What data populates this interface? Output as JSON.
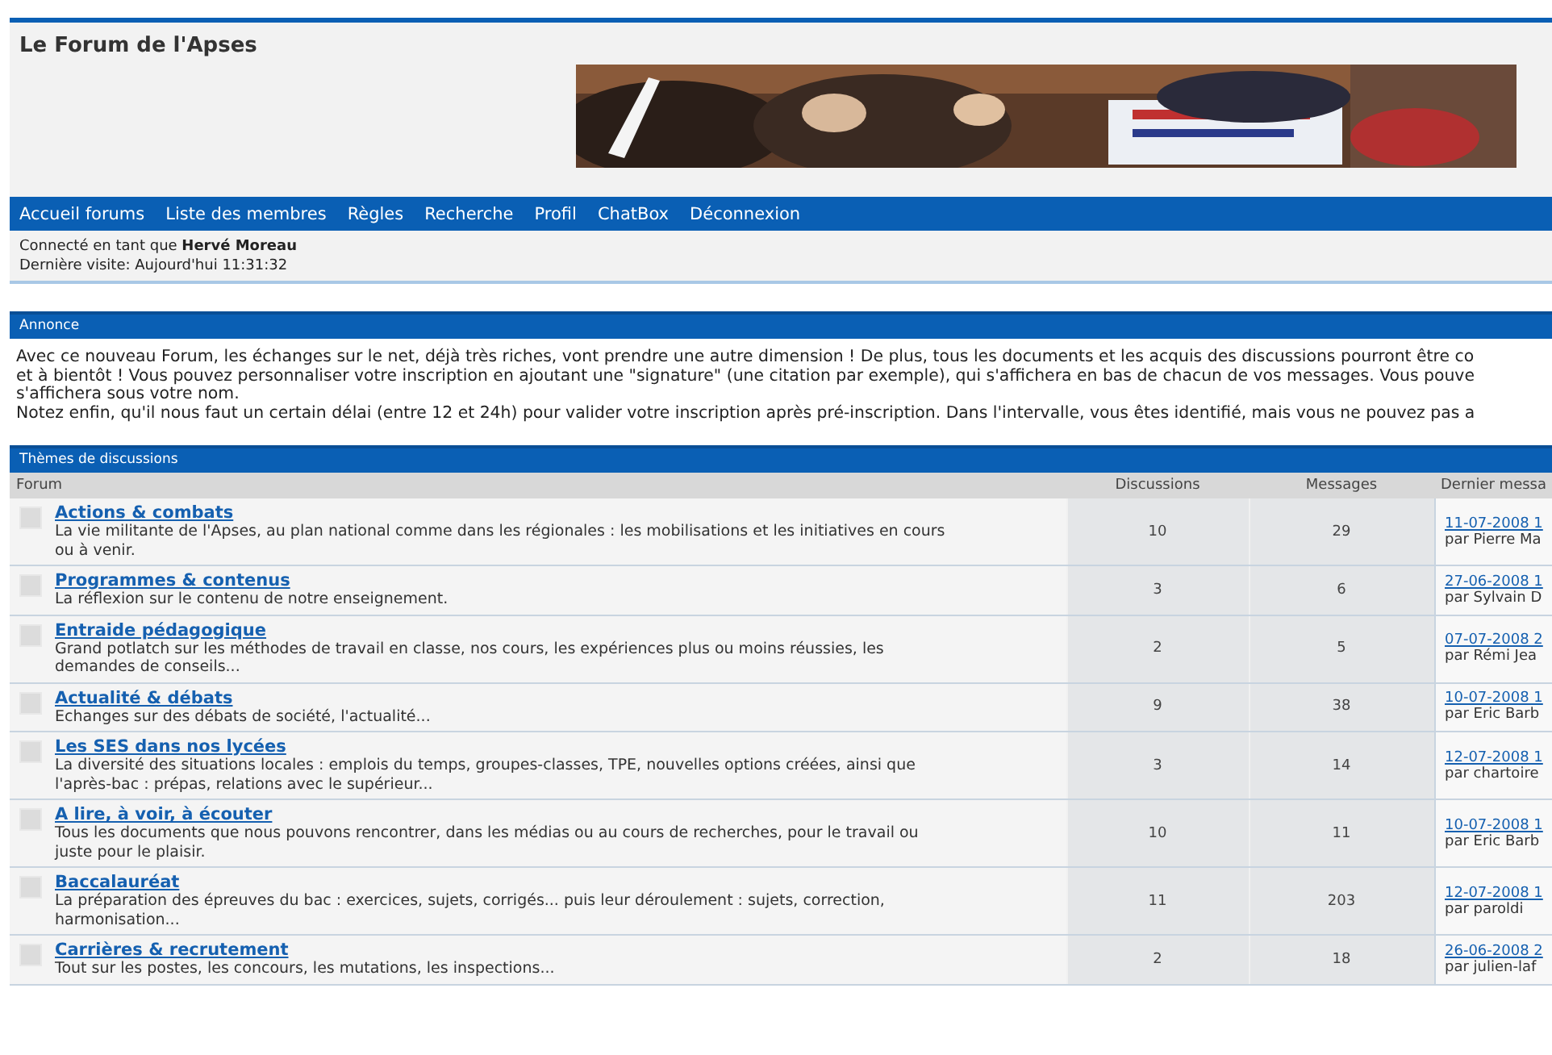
{
  "site_title": "Le Forum de l'Apses",
  "banner": {
    "kind": "picture"
  },
  "nav": [
    "Accueil forums",
    "Liste des membres",
    "Règles",
    "Recherche",
    "Profil",
    "ChatBox",
    "Déconnexion"
  ],
  "user_info": {
    "logged_in": "Connecté en tant que **Hervé Moreau**",
    "last_visit": "Dernière visite: Aujourd'hui 11:31:32"
  },
  "announcement": {
    "title": "Annonce",
    "lines": [
      "Avec ce nouveau Forum, les échanges sur le net, déjà très riches, vont prendre une autre dimension ! De plus, tous les documents et les acquis des discussions pourront être co",
      "et à bientôt ! Vous pouvez personnaliser votre inscription en ajoutant une \"signature\" (une citation par exemple), qui s'affichera en bas de chacun de vos messages. Vous pouve",
      "s'affichera sous votre nom.",
      "Notez enfin, qu'il nous faut un certain délai (entre 12 et 24h) pour valider votre inscription après pré-inscription. Dans l'intervalle, vous êtes identifié, mais vous ne pouvez pas a"
    ]
  },
  "forums": {
    "title": "Thèmes de discussions",
    "columns": [
      "Forum",
      "Discussions",
      "Messages",
      "Dernier messa"
    ],
    "rows": [
      {
        "name": "Actions & combats",
        "description": "La vie militante de l'Apses, au plan national comme dans les régionales : les mobilisations et les initiatives en cours ou à venir.",
        "discussions": "10",
        "messages": "29",
        "last_date": "11-07-2008 1",
        "last_by": "par Pierre Ma"
      },
      {
        "name": "Programmes & contenus",
        "description": "La réflexion sur le contenu de notre enseignement.",
        "discussions": "3",
        "messages": "6",
        "last_date": "27-06-2008 1",
        "last_by": "par Sylvain D"
      },
      {
        "name": "Entraide pédagogique",
        "description": "Grand potlatch sur les méthodes de travail en classe, nos cours, les expériences plus ou moins réussies, les demandes de conseils...",
        "discussions": "2",
        "messages": "5",
        "last_date": "07-07-2008 2",
        "last_by": "par Rémi Jea"
      },
      {
        "name": "Actualité & débats",
        "description": "Echanges sur des débats de société, l'actualité...",
        "discussions": "9",
        "messages": "38",
        "last_date": "10-07-2008 1",
        "last_by": "par Eric Barb"
      },
      {
        "name": "Les SES dans nos lycées",
        "description": "La diversité des situations locales : emplois du temps, groupes-classes, TPE, nouvelles options créées, ainsi que l'après-bac : prépas, relations avec le supérieur...",
        "discussions": "3",
        "messages": "14",
        "last_date": "12-07-2008 1",
        "last_by": "par chartoire"
      },
      {
        "name": "A lire, à voir, à écouter",
        "description": "Tous les documents que nous pouvons rencontrer, dans les médias ou au cours de recherches, pour le travail ou juste pour le plaisir.",
        "discussions": "10",
        "messages": "11",
        "last_date": "10-07-2008 1",
        "last_by": "par Eric Barb"
      },
      {
        "name": "Baccalauréat",
        "description": "La préparation des épreuves du bac : exercices, sujets, corrigés... puis leur déroulement : sujets, correction, harmonisation...",
        "discussions": "11",
        "messages": "203",
        "last_date": "12-07-2008 1",
        "last_by": "par paroldi"
      },
      {
        "name": "Carrières & recrutement",
        "description": "Tout sur les postes, les concours, les mutations, les inspections...",
        "discussions": "2",
        "messages": "18",
        "last_date": "26-06-2008 2",
        "last_by": "par julien-laf"
      }
    ]
  }
}
